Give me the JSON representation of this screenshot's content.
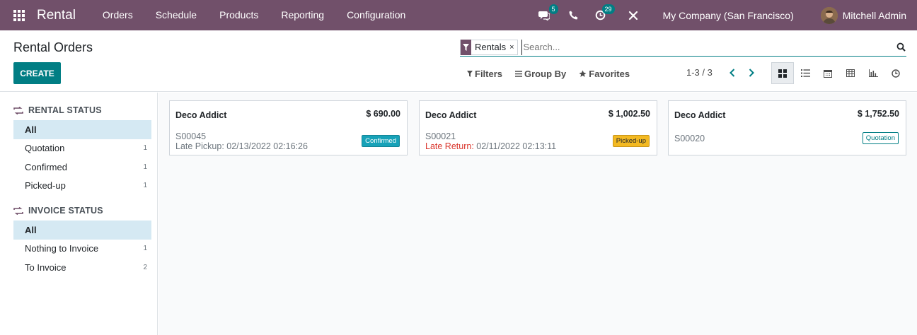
{
  "navbar": {
    "app_name": "Rental",
    "menu": [
      "Orders",
      "Schedule",
      "Products",
      "Reporting",
      "Configuration"
    ],
    "messages_badge": "5",
    "activities_badge": "29",
    "company": "My Company (San Francisco)",
    "user": "Mitchell Admin"
  },
  "control": {
    "title": "Rental Orders",
    "create_label": "CREATE",
    "search": {
      "facet_value": "Rentals",
      "facet_close": "×",
      "placeholder": "Search..."
    },
    "filters_label": "Filters",
    "groupby_label": "Group By",
    "favorites_label": "Favorites",
    "pager": "1-3 / 3"
  },
  "sidebar": {
    "rental_status": {
      "title": "RENTAL STATUS",
      "items": [
        {
          "label": "All",
          "count": ""
        },
        {
          "label": "Quotation",
          "count": "1"
        },
        {
          "label": "Confirmed",
          "count": "1"
        },
        {
          "label": "Picked-up",
          "count": "1"
        }
      ]
    },
    "invoice_status": {
      "title": "INVOICE STATUS",
      "items": [
        {
          "label": "All",
          "count": ""
        },
        {
          "label": "Nothing to Invoice",
          "count": "1"
        },
        {
          "label": "To Invoice",
          "count": "2"
        }
      ]
    }
  },
  "cards": [
    {
      "customer": "Deco Addict",
      "amount": "$ 690.00",
      "reference": "S00045",
      "note_prefix": "",
      "note": "Late Pickup: 02/13/2022 02:16:26",
      "status": "Confirmed"
    },
    {
      "customer": "Deco Addict",
      "amount": "$ 1,002.50",
      "reference": "S00021",
      "note_prefix": "Late Return:",
      "note": " 02/11/2022 02:13:11",
      "status": "Picked-up"
    },
    {
      "customer": "Deco Addict",
      "amount": "$ 1,752.50",
      "reference": "S00020",
      "note_prefix": "",
      "note": "",
      "status": "Quotation"
    }
  ],
  "colors": {
    "brand": "#71506a",
    "accent": "#017e84",
    "late": "#d9342b",
    "confirmed": "#17a2b8",
    "picked_up": "#f3b922"
  }
}
